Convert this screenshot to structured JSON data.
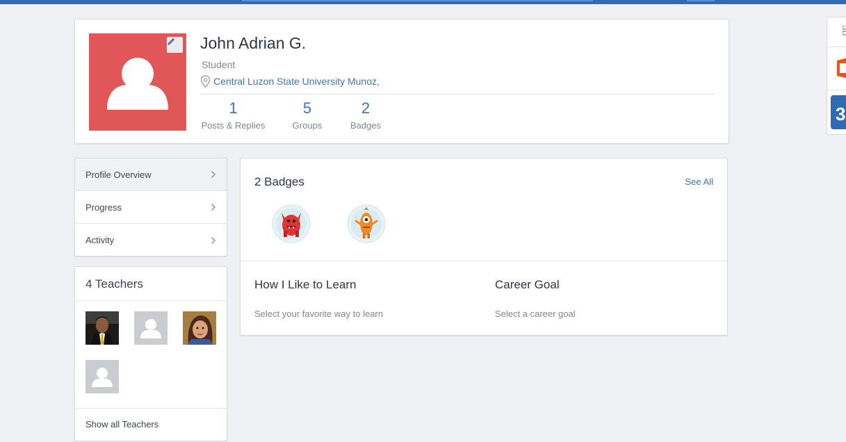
{
  "profile": {
    "name": "John Adrian G.",
    "role": "Student",
    "location": "Central Luzon State University Munoz,",
    "avatar_color": "#e15656",
    "stats": [
      {
        "value": "1",
        "label": "Posts & Replies"
      },
      {
        "value": "5",
        "label": "Groups"
      },
      {
        "value": "2",
        "label": "Badges"
      }
    ]
  },
  "nav": {
    "items": [
      {
        "label": "Profile Overview",
        "icon": "chevron-right-icon"
      },
      {
        "label": "Progress",
        "icon": "chevron-right-icon"
      },
      {
        "label": "Activity",
        "icon": "chevron-right-icon"
      }
    ]
  },
  "teachers": {
    "title": "4 Teachers",
    "show_all": "Show all Teachers"
  },
  "badges": {
    "title": "2 Badges",
    "see_all": "See All"
  },
  "learn": {
    "title": "How I Like to Learn",
    "subtitle": "Select your favorite way to learn"
  },
  "career": {
    "title": "Career Goal",
    "subtitle": "Select a career goal"
  },
  "colors": {
    "accent": "#3d74b6",
    "topbar": "#2f6bb4",
    "background": "#eef0f4"
  }
}
